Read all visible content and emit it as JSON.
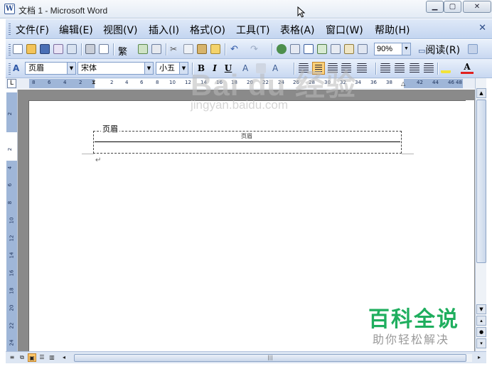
{
  "window": {
    "title": "文档 1 - Microsoft Word",
    "app_icon_letter": "W"
  },
  "menu": {
    "items": [
      "文件(F)",
      "编辑(E)",
      "视图(V)",
      "插入(I)",
      "格式(O)",
      "工具(T)",
      "表格(A)",
      "窗口(W)",
      "帮助(H)"
    ]
  },
  "toolbar": {
    "zoom": "90%",
    "read_label": "阅读(R)",
    "traditional_char": "繁"
  },
  "format_toolbar": {
    "style": "页眉",
    "font": "宋体",
    "size": "小五",
    "bold": "B",
    "italic": "I",
    "underline": "U",
    "font_color_letter": "A"
  },
  "ruler": {
    "numbers": [
      "8",
      "6",
      "4",
      "2",
      "",
      "2",
      "4",
      "6",
      "8",
      "10",
      "12",
      "14",
      "16",
      "18",
      "20",
      "22",
      "24",
      "26",
      "28",
      "30",
      "32",
      "34",
      "36",
      "38",
      "",
      "42",
      "44",
      "46",
      "48"
    ],
    "vertical_numbers": [
      "2",
      "",
      "2",
      "4",
      "6",
      "8",
      "10",
      "12",
      "14",
      "16",
      "18",
      "20",
      "22",
      "24"
    ]
  },
  "document": {
    "header_tab_label": "页眉",
    "header_inner_text": "页眉",
    "paragraph_mark": "↵"
  },
  "watermark": {
    "baidu": "Bai du 经验",
    "url": "jingyan.baidu.com",
    "logo_main": "百科全说",
    "logo_sub": "助你轻松解决"
  },
  "colors": {
    "menu_bg": "#c3d5f0",
    "logo_green": "#1fae5e",
    "active_button": "#ffd27a"
  }
}
